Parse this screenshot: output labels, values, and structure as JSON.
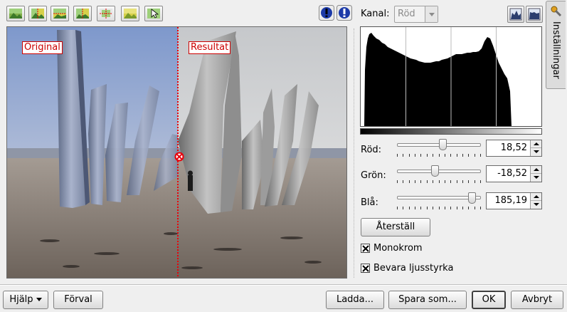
{
  "toolbar": {
    "buttons": [
      {
        "name": "original-preview-icon"
      },
      {
        "name": "split-vertical-original-icon"
      },
      {
        "name": "split-horizontal-icon"
      },
      {
        "name": "split-vertical-icon"
      },
      {
        "name": "split-horizontal-both-icon"
      },
      {
        "name": "result-preview-icon"
      },
      {
        "name": "pointer-icon"
      }
    ],
    "info_buttons": [
      {
        "name": "underexposure-indicator-icon"
      },
      {
        "name": "overexposure-indicator-icon"
      }
    ]
  },
  "preview": {
    "original_label": "Original",
    "result_label": "Resultat",
    "split_color": "#e8000b"
  },
  "channel": {
    "label": "Kanal:",
    "selected": "Röd"
  },
  "histogram_buttons": [
    {
      "name": "linear-histogram-icon"
    },
    {
      "name": "log-histogram-icon"
    }
  ],
  "side_tab": {
    "label": "Inställningar",
    "icon": "wrench-icon"
  },
  "sliders": [
    {
      "label": "Röd:",
      "value": "18,52",
      "thumb_fraction": 0.55
    },
    {
      "label": "Grön:",
      "value": "-18,52",
      "thumb_fraction": 0.45
    },
    {
      "label": "Blå:",
      "value": "185,19",
      "thumb_fraction": 0.93
    }
  ],
  "reset_button": "Återställ",
  "checkboxes": [
    {
      "label": "Monokrom",
      "checked": true
    },
    {
      "label": "Bevara ljusstyrka",
      "checked": true
    }
  ],
  "footer": {
    "help": "Hjälp",
    "presets": "Förval",
    "load": "Ladda...",
    "save_as": "Spara som...",
    "ok": "OK",
    "cancel": "Avbryt"
  },
  "colors": {
    "accent_red": "#cc0000",
    "sky_original": "#8ea6d4",
    "sand": "#857a6e"
  }
}
